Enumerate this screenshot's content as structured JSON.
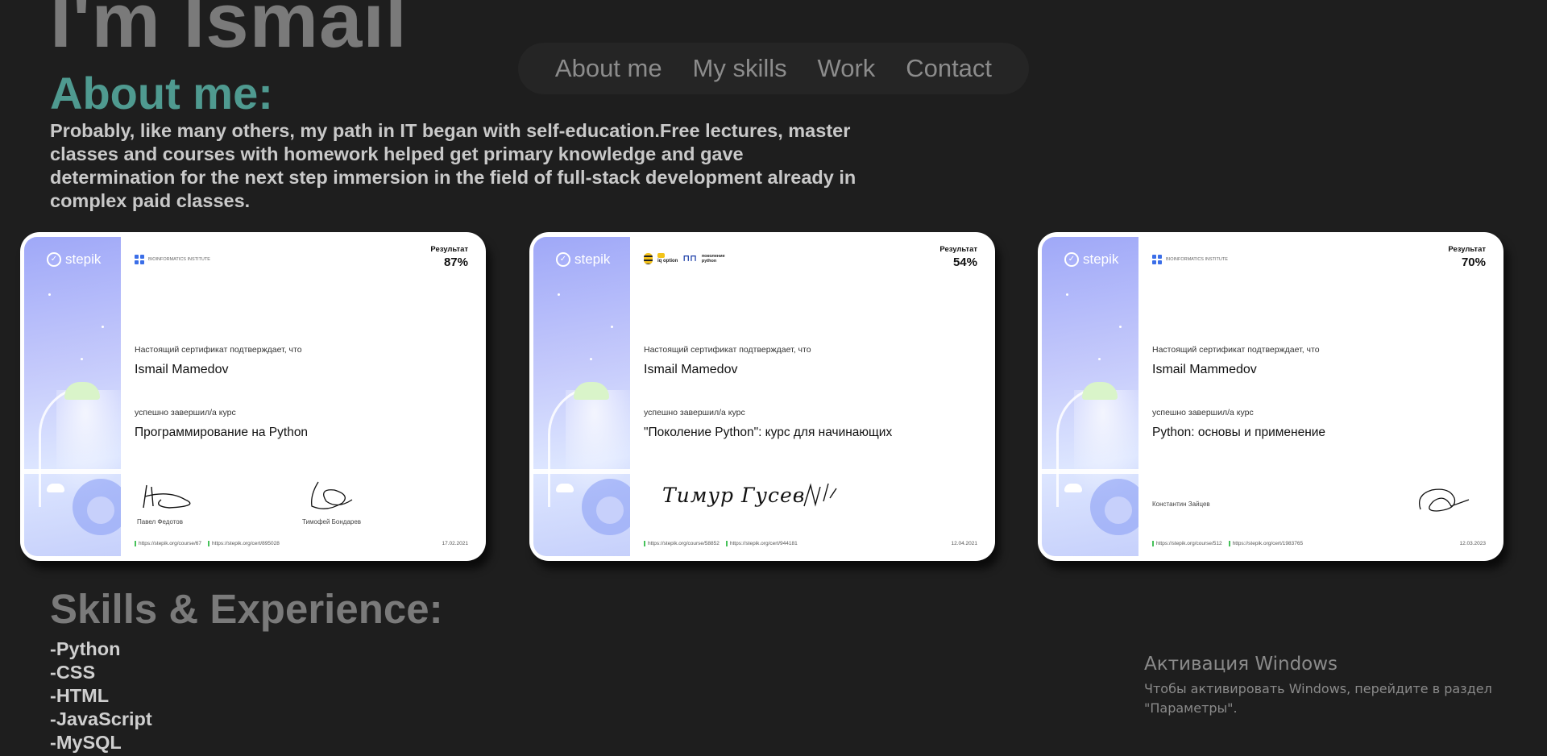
{
  "hero": {
    "name": "I'm Ismail"
  },
  "nav": {
    "items": [
      "About me",
      "My skills",
      "Work",
      "Contact"
    ]
  },
  "about": {
    "title": "About me:",
    "text": "Probably, like many others, my path in IT began with self-education.Free lectures, master classes and courses with homework helped get primary knowledge and gave determination for the next step immersion in the field of full-stack development already in complex paid classes."
  },
  "certificates": [
    {
      "brand": "stepik",
      "org": "Bioinformatics Institute",
      "result_label": "Результат",
      "result": "87%",
      "confirm_text": "Настоящий сертификат подтверждает, что",
      "person": "Ismail Mamedov",
      "completed_text": "успешно завершил/а курс",
      "course": "Программирование на Python",
      "signers": [
        "Павел Федотов",
        "Тимофей Бондарев"
      ],
      "links": [
        "https://stepik.org/course/67",
        "https://stepik.org/cert/895028"
      ],
      "date": "17.02.2021"
    },
    {
      "brand": "stepik",
      "org": "",
      "partner_labels": [
        "iq option",
        "поколение python"
      ],
      "result_label": "Результат",
      "result": "54%",
      "confirm_text": "Настоящий сертификат подтверждает, что",
      "person": "Ismail Mamedov",
      "completed_text": "успешно завершил/а курс",
      "course": "\"Поколение Python\": курс для начинающих",
      "signers": [],
      "signature_text": "Тимур Гусев",
      "links": [
        "https://stepik.org/course/58852",
        "https://stepik.org/cert/944181"
      ],
      "date": "12.04.2021"
    },
    {
      "brand": "stepik",
      "org": "Bioinformatics Institute",
      "result_label": "Результат",
      "result": "70%",
      "confirm_text": "Настоящий сертификат подтверждает, что",
      "person": "Ismail Mammedov",
      "completed_text": "успешно завершил/а курс",
      "course": "Python: основы и применение",
      "signers": [
        "Константин Зайцев"
      ],
      "links": [
        "https://stepik.org/course/512",
        "https://stepik.org/cert/1983765"
      ],
      "date": "12.03.2023"
    }
  ],
  "skills": {
    "title": "Skills & Experience:",
    "items": [
      "-Python",
      "-CSS",
      "-HTML",
      "-JavaScript",
      "-MySQL"
    ]
  },
  "windows_activation": {
    "title": "Активация Windows",
    "text": "Чтобы активировать Windows, перейдите в раздел \"Параметры\"."
  }
}
